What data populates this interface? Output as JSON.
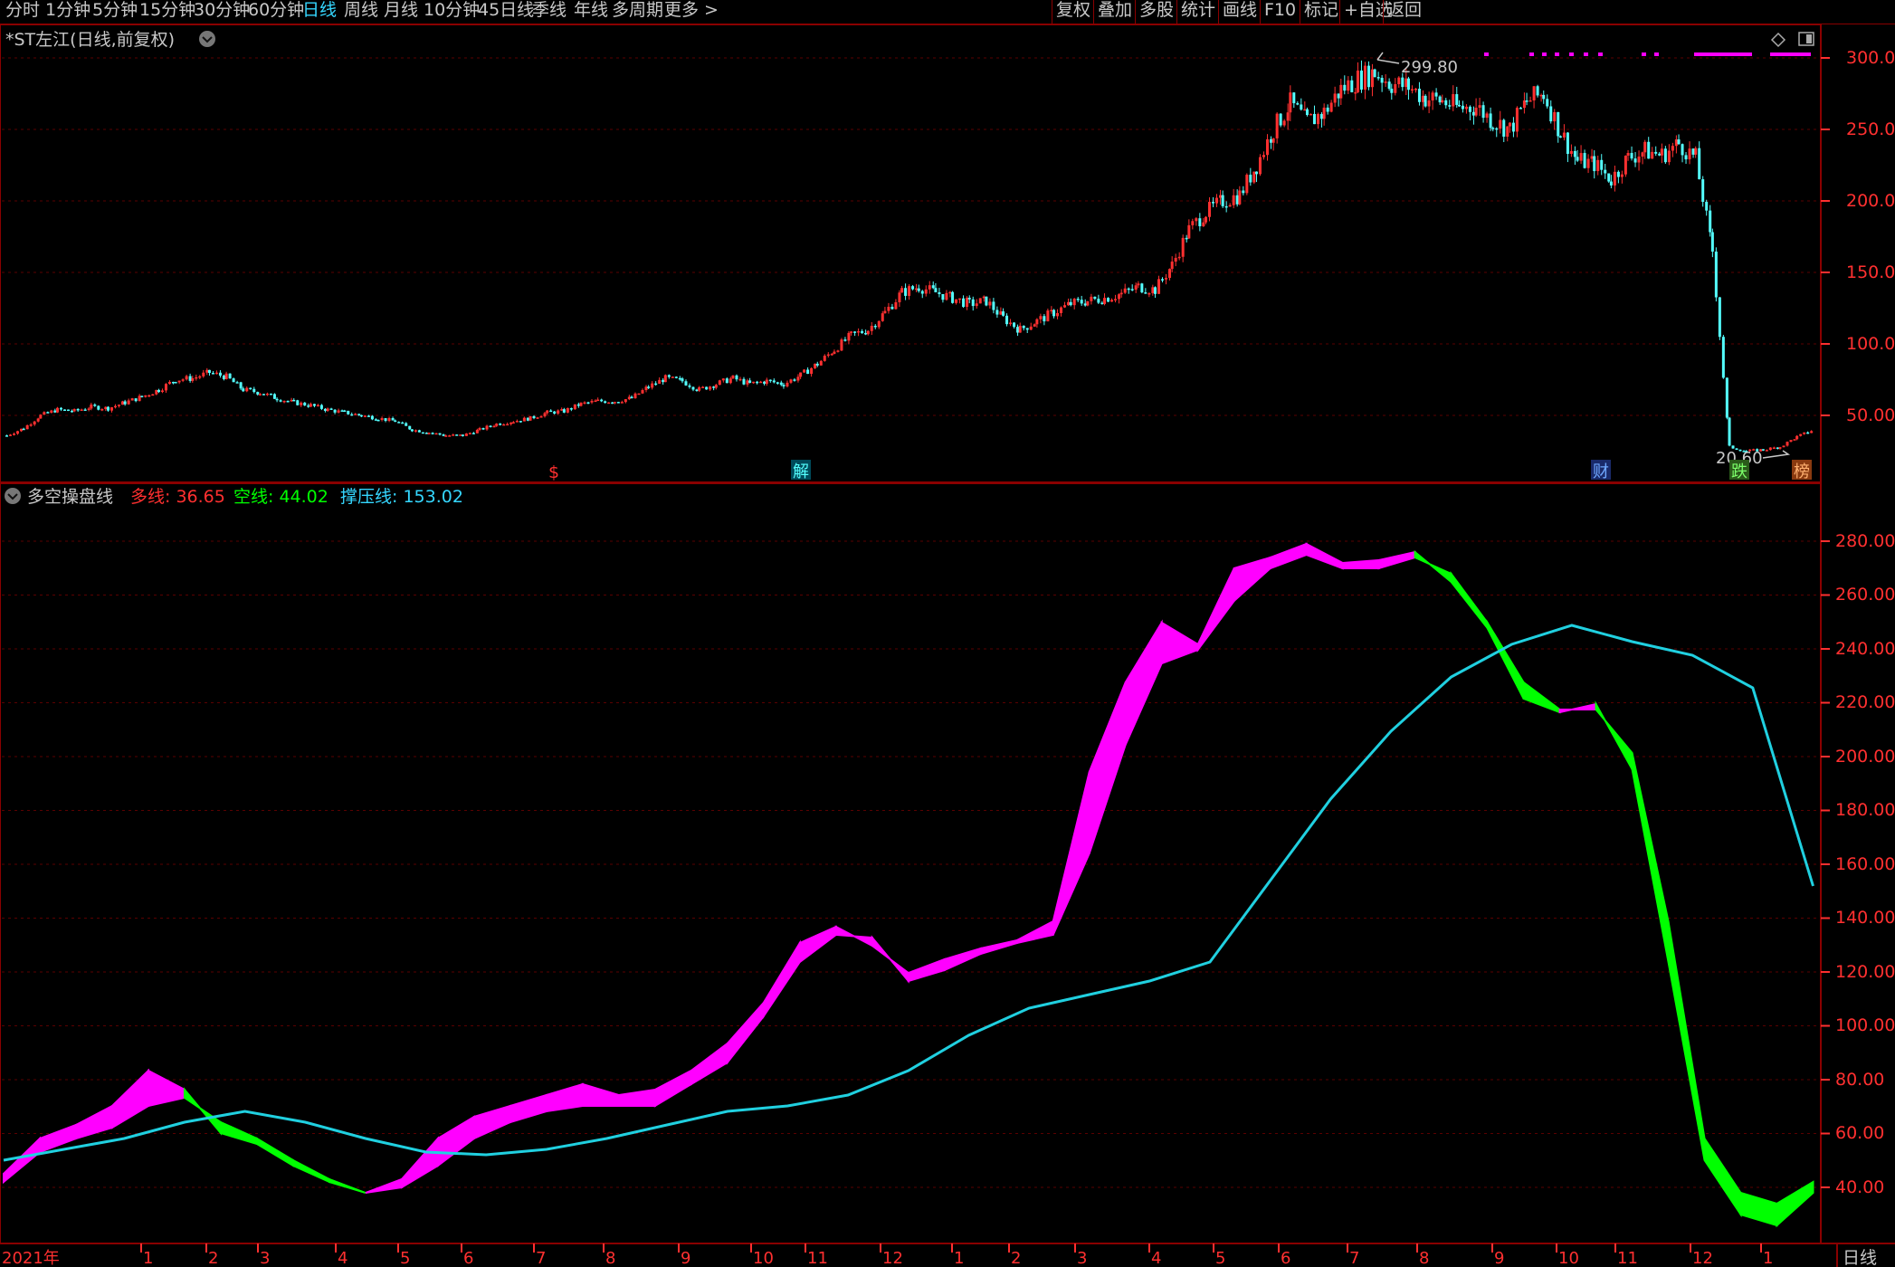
{
  "toolbar": {
    "periods": [
      "分时",
      "1分钟",
      "5分钟",
      "15分钟",
      "30分钟",
      "60分钟",
      "日线",
      "周线",
      "月线",
      "10分钟",
      "45日线",
      "季线",
      "年线",
      "多周期",
      "更多 >"
    ],
    "active_period": "日线",
    "right_buttons": [
      "复权",
      "叠加",
      "多股",
      "统计",
      "画线",
      "F10",
      "标记",
      "+自选",
      "返回"
    ]
  },
  "main_chart": {
    "title": "*ST左江(日线,前复权)",
    "high_label": "299.80",
    "low_label": "20.60",
    "y_ticks": [
      "300.0",
      "250.0",
      "200.0",
      "150.0",
      "100.0",
      "50.00"
    ],
    "event_markers": [
      "$",
      "解",
      "财",
      "跌",
      "榜"
    ],
    "colors": {
      "up": "#ff3030",
      "down": "#54ffff",
      "marker_dots": "#ff00ff"
    }
  },
  "indicator": {
    "name": "多空操盘线",
    "values": [
      {
        "label": "多线: 36.65",
        "color": "#ff3030"
      },
      {
        "label": "空线: 44.02",
        "color": "#00ff00"
      },
      {
        "label": "撑压线: 153.02",
        "color": "#35d7ff"
      }
    ],
    "y_ticks": [
      "280.00",
      "260.00",
      "240.00",
      "220.00",
      "200.00",
      "180.00",
      "160.00",
      "140.00",
      "120.00",
      "100.00",
      "80.00",
      "60.00",
      "40.00"
    ],
    "colors": {
      "bull": "#ff00ff",
      "bear": "#00ff00",
      "support": "#20d0e0"
    }
  },
  "x_axis": {
    "labels": [
      "2021年",
      "1",
      "2",
      "3",
      "4",
      "5",
      "6",
      "7",
      "8",
      "9",
      "10",
      "11",
      "12",
      "1",
      "2",
      "3",
      "4",
      "5",
      "6",
      "7",
      "8",
      "9",
      "10",
      "11",
      "12",
      "1"
    ],
    "period_badge": "日线"
  },
  "chart_data": [
    {
      "type": "candlestick",
      "title": "*ST左江(日线,前复权)",
      "ylim": [
        10,
        310
      ],
      "x": [
        0,
        14,
        28,
        42,
        56,
        70,
        84,
        98,
        112,
        126,
        140,
        154,
        168,
        182,
        196,
        210,
        224,
        238,
        252,
        266,
        280,
        294,
        308,
        322,
        336,
        350,
        364,
        378,
        392,
        406,
        420,
        434,
        448,
        462,
        476,
        490,
        504,
        518,
        532,
        546,
        560,
        574,
        588,
        602,
        616,
        630,
        644,
        658,
        672,
        686,
        700,
        714,
        728,
        742,
        756,
        770,
        784,
        798,
        812,
        826,
        840,
        854,
        868,
        882,
        896,
        910,
        924,
        938,
        952,
        966,
        980,
        994,
        1008,
        1022,
        1036,
        1050,
        1064,
        1078,
        1092,
        1106,
        1120,
        1134,
        1148,
        1162,
        1176,
        1190,
        1204,
        1218,
        1232,
        1246,
        1260,
        1274,
        1288,
        1302,
        1316,
        1330,
        1344,
        1358,
        1372,
        1386,
        1400,
        1414,
        1428,
        1442,
        1456,
        1470,
        1484,
        1498
      ],
      "close": [
        36,
        41,
        50,
        54,
        53,
        56,
        55,
        59,
        63,
        68,
        75,
        76,
        80,
        77,
        68,
        66,
        62,
        59,
        57,
        54,
        52,
        50,
        48,
        46,
        40,
        38,
        36,
        36,
        40,
        44,
        46,
        48,
        52,
        53,
        58,
        60,
        60,
        62,
        70,
        76,
        74,
        68,
        72,
        76,
        72,
        74,
        72,
        78,
        86,
        96,
        106,
        110,
        122,
        136,
        140,
        136,
        132,
        128,
        130,
        118,
        110,
        116,
        122,
        128,
        130,
        132,
        135,
        140,
        138,
        155,
        180,
        192,
        200,
        204,
        225,
        250,
        268,
        255,
        262,
        278,
        285,
        290,
        282,
        280,
        272,
        270,
        265,
        266,
        256,
        250,
        270,
        275,
        248,
        228,
        226,
        215,
        230,
        235,
        232,
        240,
        230,
        165,
        28,
        25,
        26,
        28,
        35,
        40
      ]
    },
    {
      "type": "area",
      "title": "多空操盘线",
      "x_range": [
        0,
        1500
      ],
      "ylim": [
        30,
        290
      ],
      "series": [
        {
          "name": "多线",
          "x": [
            0,
            30,
            60,
            90,
            120,
            150,
            180,
            210,
            240,
            270,
            300,
            330,
            360,
            390,
            420,
            450,
            480,
            510,
            540,
            570,
            600,
            630,
            660,
            690,
            720,
            750,
            780,
            810,
            840,
            870,
            900,
            930,
            960,
            990,
            1020,
            1050,
            1080,
            1110,
            1140,
            1170,
            1200,
            1230,
            1260,
            1290,
            1320,
            1350,
            1380,
            1410,
            1440,
            1470,
            1500
          ],
          "values": [
            47,
            60,
            65,
            72,
            85,
            78,
            62,
            58,
            50,
            44,
            40,
            45,
            60,
            68,
            72,
            76,
            80,
            76,
            78,
            85,
            95,
            110,
            132,
            138,
            131,
            121,
            126,
            130,
            133,
            140,
            195,
            228,
            250,
            242,
            270,
            274,
            279,
            272,
            273,
            276,
            265,
            248,
            222,
            217,
            220,
            196,
            125,
            52,
            32,
            28,
            40
          ]
        },
        {
          "name": "空线",
          "x": [
            0,
            30,
            60,
            90,
            120,
            150,
            180,
            210,
            240,
            270,
            300,
            330,
            360,
            390,
            420,
            450,
            480,
            510,
            540,
            570,
            600,
            630,
            660,
            690,
            720,
            750,
            780,
            810,
            840,
            870,
            900,
            930,
            960,
            990,
            1020,
            1050,
            1080,
            1110,
            1140,
            1170,
            1200,
            1230,
            1260,
            1290,
            1320,
            1350,
            1380,
            1410,
            1440,
            1470,
            1500
          ],
          "values": [
            44,
            55,
            60,
            64,
            72,
            75,
            66,
            60,
            52,
            45,
            40,
            42,
            50,
            60,
            66,
            70,
            72,
            72,
            72,
            80,
            88,
            105,
            125,
            135,
            134,
            118,
            122,
            128,
            132,
            135,
            165,
            205,
            235,
            240,
            258,
            270,
            275,
            270,
            270,
            274,
            268,
            250,
            228,
            218,
            218,
            202,
            140,
            60,
            40,
            36,
            44
          ]
        },
        {
          "name": "撑压线",
          "x": [
            0,
            50,
            100,
            150,
            200,
            250,
            300,
            350,
            400,
            450,
            500,
            550,
            600,
            650,
            700,
            750,
            800,
            850,
            900,
            950,
            1000,
            1050,
            1100,
            1150,
            1200,
            1250,
            1300,
            1350,
            1400,
            1450,
            1500
          ],
          "values": [
            52,
            56,
            60,
            66,
            70,
            66,
            60,
            55,
            54,
            56,
            60,
            65,
            70,
            72,
            76,
            85,
            98,
            108,
            113,
            118,
            125,
            155,
            185,
            210,
            230,
            242,
            249,
            243,
            238,
            226,
            153
          ]
        }
      ]
    }
  ]
}
